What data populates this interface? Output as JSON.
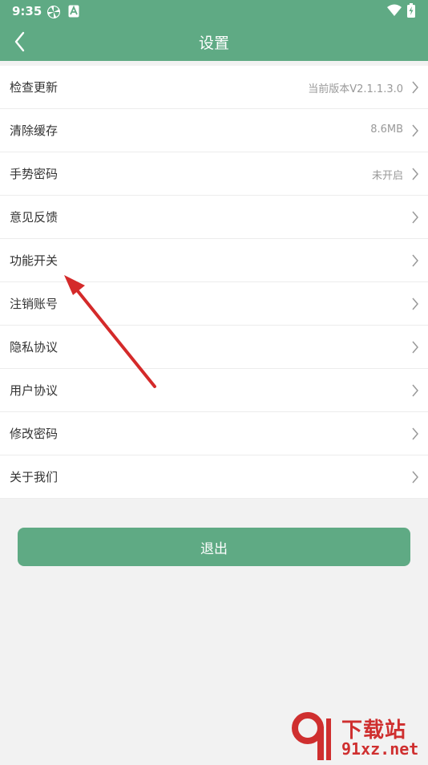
{
  "status_bar": {
    "time": "9:35",
    "icons": [
      "pinwheel-icon",
      "a-badge-icon",
      "wifi-icon",
      "battery-charging-icon"
    ]
  },
  "header": {
    "title": "设置",
    "back_icon": "chevron-left-icon"
  },
  "settings": {
    "items": [
      {
        "label": "检查更新",
        "value": "当前版本V2.1.1.3.0"
      },
      {
        "label": "清除缓存",
        "value": "8.6MB"
      },
      {
        "label": "手势密码",
        "value": "未开启"
      },
      {
        "label": "意见反馈",
        "value": ""
      },
      {
        "label": "功能开关",
        "value": ""
      },
      {
        "label": "注销账号",
        "value": ""
      },
      {
        "label": "隐私协议",
        "value": ""
      },
      {
        "label": "用户协议",
        "value": ""
      },
      {
        "label": "修改密码",
        "value": ""
      },
      {
        "label": "关于我们",
        "value": ""
      }
    ]
  },
  "logout_label": "退出",
  "watermark": {
    "text1": "下载站",
    "text2": "91xz.net"
  },
  "colors": {
    "accent": "#5faa84",
    "annotation": "#d42a2a",
    "watermark": "#cf2f2f"
  }
}
